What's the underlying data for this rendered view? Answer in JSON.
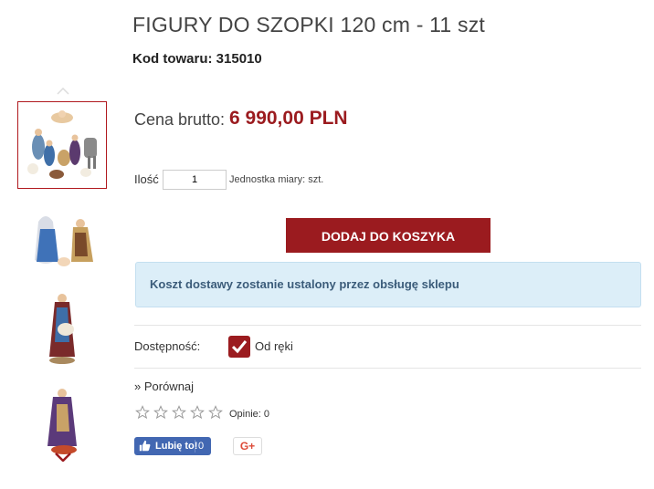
{
  "product": {
    "title": "FIGURY DO SZOPKI 120 cm - 11 szt",
    "sku_label": "Kod towaru:",
    "sku_value": "315010",
    "price_label": "Cena brutto:",
    "price": "6 990,00 PLN",
    "quantity_label": "Ilość",
    "quantity_value": "1",
    "unit_text": "Jednostka miary: szt.",
    "add_to_cart": "DODAJ DO KOSZYKA",
    "shipping_notice": "Koszt dostawy zostanie ustalony przez obsługę sklepu",
    "availability_label": "Dostępność:",
    "availability_value": "Od ręki",
    "compare": "» Porównaj",
    "reviews_text": "Opinie: 0",
    "rating": 0,
    "rating_max": 5
  },
  "social": {
    "fb_label": "Lubię to!",
    "fb_count": "0",
    "gplus_label": "G+"
  },
  "gallery": {
    "thumbnails": [
      "nativity-set",
      "mary-and-joseph",
      "shepherd",
      "kneeling-figure"
    ],
    "active_index": 0
  },
  "colors": {
    "accent": "#9b1b1f",
    "notice_bg": "#dceef8",
    "notice_text": "#3b5c7a",
    "facebook": "#4267b2"
  }
}
